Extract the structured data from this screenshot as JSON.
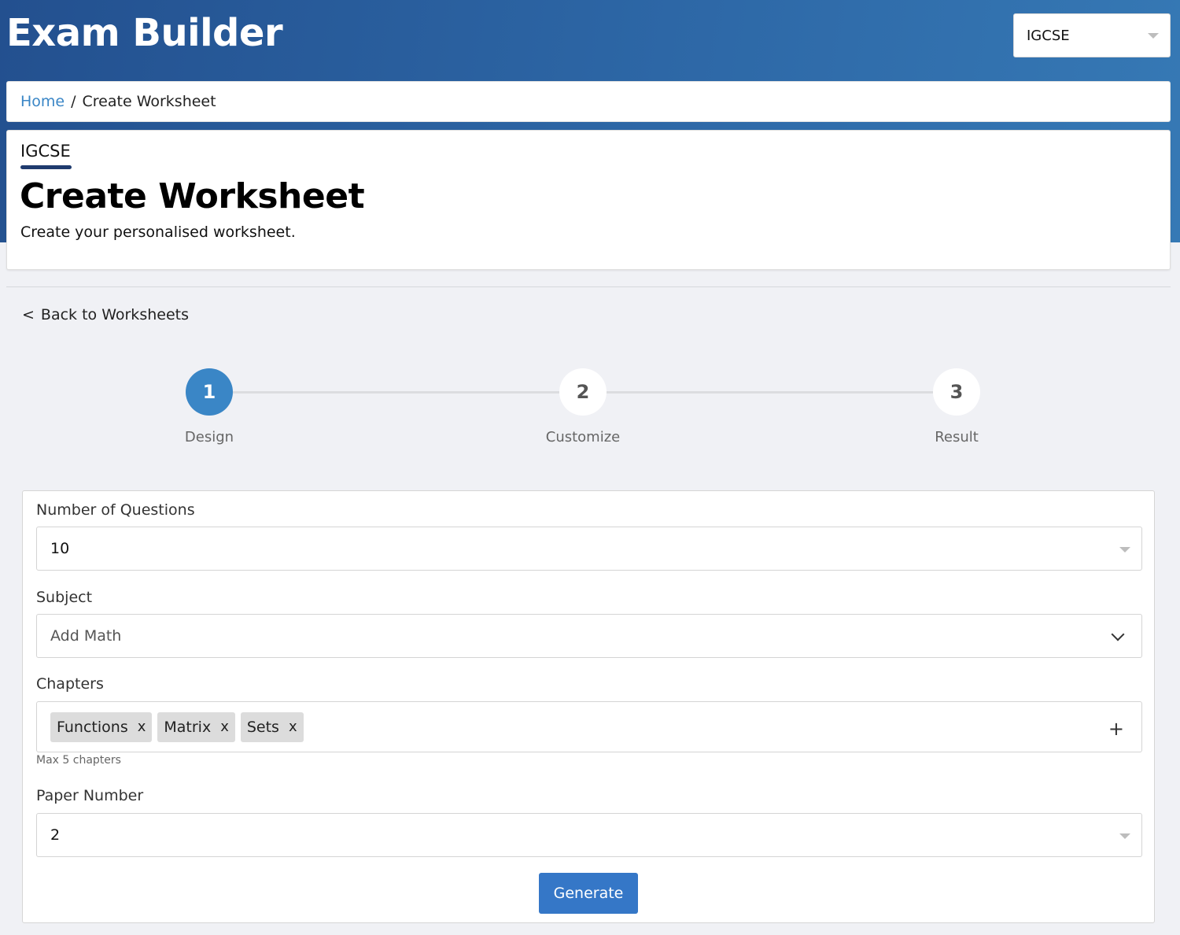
{
  "app": {
    "title": "Exam Builder"
  },
  "header": {
    "board_select_value": "IGCSE"
  },
  "breadcrumb": {
    "home": "Home",
    "separator": "/",
    "current": "Create Worksheet"
  },
  "page": {
    "board_tag": "IGCSE",
    "title": "Create Worksheet",
    "subtitle": "Create your personalised worksheet."
  },
  "back_link": {
    "chevron": "<",
    "label": "Back to Worksheets"
  },
  "stepper": {
    "active_color": "#3a86c6",
    "steps": [
      {
        "number": "1",
        "label": "Design",
        "active": true
      },
      {
        "number": "2",
        "label": "Customize",
        "active": false
      },
      {
        "number": "3",
        "label": "Result",
        "active": false
      }
    ]
  },
  "form": {
    "num_questions": {
      "label": "Number of Questions",
      "value": "10"
    },
    "subject": {
      "label": "Subject",
      "value": "Add Math"
    },
    "chapters": {
      "label": "Chapters",
      "chips": [
        {
          "label": "Functions",
          "remove": "x"
        },
        {
          "label": "Matrix",
          "remove": "x"
        },
        {
          "label": "Sets",
          "remove": "x"
        }
      ],
      "add_icon": "+",
      "hint": "Max 5 chapters"
    },
    "paper_number": {
      "label": "Paper Number",
      "value": "2"
    },
    "generate_label": "Generate",
    "generate_color": "#3577c7"
  }
}
